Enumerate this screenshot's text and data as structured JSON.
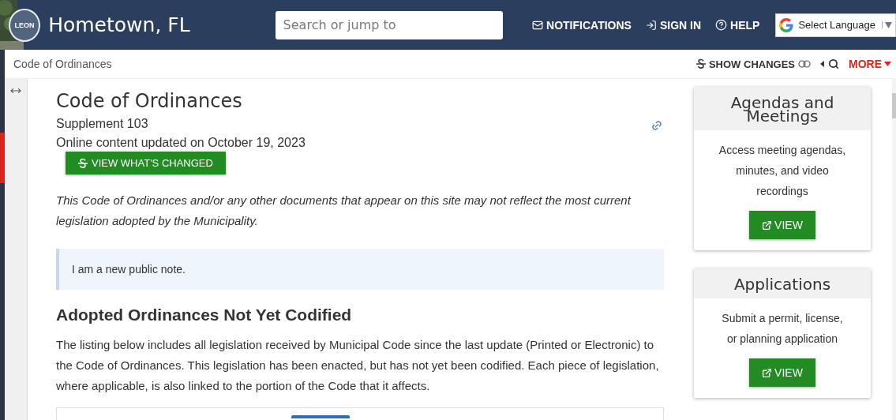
{
  "header": {
    "logo_text": "LEON",
    "site_title": "Hometown, FL",
    "search": {
      "placeholder": "Search or jump to"
    },
    "nav": [
      {
        "kind": "mail",
        "label": "NOTIFICATIONS"
      },
      {
        "kind": "signin",
        "label": "SIGN IN"
      },
      {
        "kind": "help",
        "label": "HELP"
      }
    ],
    "language": "Select Language"
  },
  "toolbar": {
    "breadcrumb": "Code of Ordinances",
    "show_changes": "SHOW CHANGES",
    "more": "MORE"
  },
  "main": {
    "title": "Code of Ordinances",
    "supplement": "Supplement 103",
    "updated": "Online content updated on October 19, 2023",
    "changed_button": "VIEW WHAT'S CHANGED",
    "disclaimer": "This Code of Ordinances and/or any other documents that appear on this site may not reflect the most current legislation adopted by the Municipality.",
    "note": "I am a new public note.",
    "section_title": "Adopted Ordinances Not Yet Codified",
    "section_text": "The listing below includes all legislation received by Municipal Code since the last update (Printed or Electronic) to the Code of Ordinances. This legislation has been enacted, but has not yet been codified. Each piece of legislation, where applicable, is also linked to the portion of the Code that it affects."
  },
  "cards": [
    {
      "title": "Agendas and Meetings",
      "text": "Access meeting agendas, minutes, and video recordings",
      "button": "VIEW"
    },
    {
      "title": "Applications",
      "text": "Submit a permit, license, or planning application",
      "button": "VIEW"
    }
  ]
}
